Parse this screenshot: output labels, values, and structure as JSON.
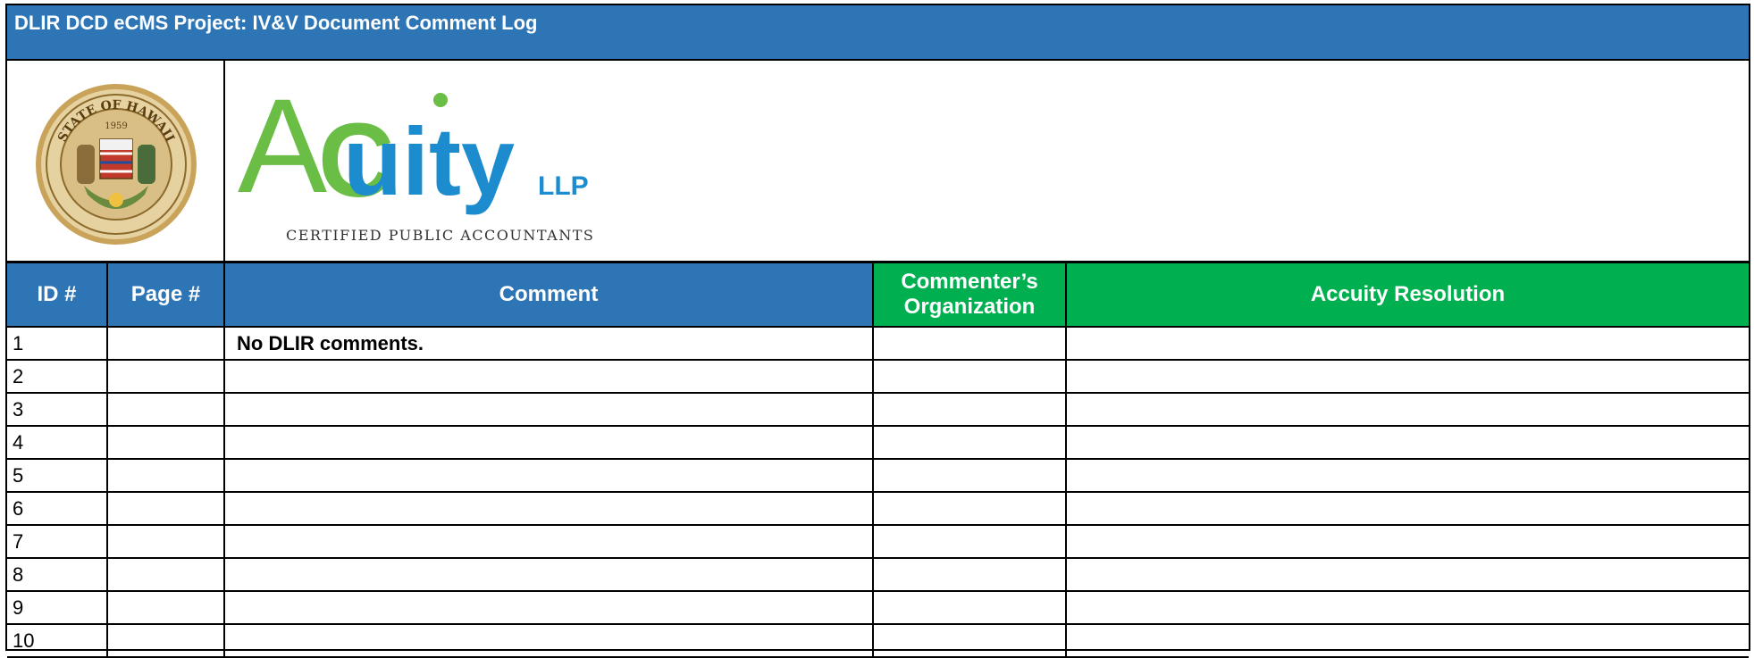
{
  "title": "DLIR DCD eCMS Project:  IV&V Document Comment Log",
  "seal": {
    "name": "state-of-hawaii-seal",
    "text_top": "STATE OF HAWAII",
    "year": "1959"
  },
  "logo": {
    "name": "accuity-logo",
    "word_a": "A",
    "word_c": "C",
    "word_rest": "uity",
    "suffix": "LLP",
    "tagline": "CERTIFIED PUBLIC ACCOUNTANTS",
    "colors": {
      "green": "#6abd45",
      "blue": "#1c8ccf"
    }
  },
  "columns": [
    {
      "label": "ID #"
    },
    {
      "label": "Page #"
    },
    {
      "label": "Comment"
    },
    {
      "label": "Commenter’s\nOrganization"
    },
    {
      "label": "Accuity Resolution"
    }
  ],
  "rows": [
    {
      "id": "1",
      "page": "",
      "comment": "No DLIR comments.",
      "org": "",
      "resolution": ""
    },
    {
      "id": "2",
      "page": "",
      "comment": "",
      "org": "",
      "resolution": ""
    },
    {
      "id": "3",
      "page": "",
      "comment": "",
      "org": "",
      "resolution": ""
    },
    {
      "id": "4",
      "page": "",
      "comment": "",
      "org": "",
      "resolution": ""
    },
    {
      "id": "5",
      "page": "",
      "comment": "",
      "org": "",
      "resolution": ""
    },
    {
      "id": "6",
      "page": "",
      "comment": "",
      "org": "",
      "resolution": ""
    },
    {
      "id": "7",
      "page": "",
      "comment": "",
      "org": "",
      "resolution": ""
    },
    {
      "id": "8",
      "page": "",
      "comment": "",
      "org": "",
      "resolution": ""
    },
    {
      "id": "9",
      "page": "",
      "comment": "",
      "org": "",
      "resolution": ""
    },
    {
      "id": "10",
      "page": "",
      "comment": "",
      "org": "",
      "resolution": ""
    }
  ],
  "colors": {
    "header_blue": "#2e75b6",
    "header_green": "#00b050",
    "border": "#000000"
  }
}
